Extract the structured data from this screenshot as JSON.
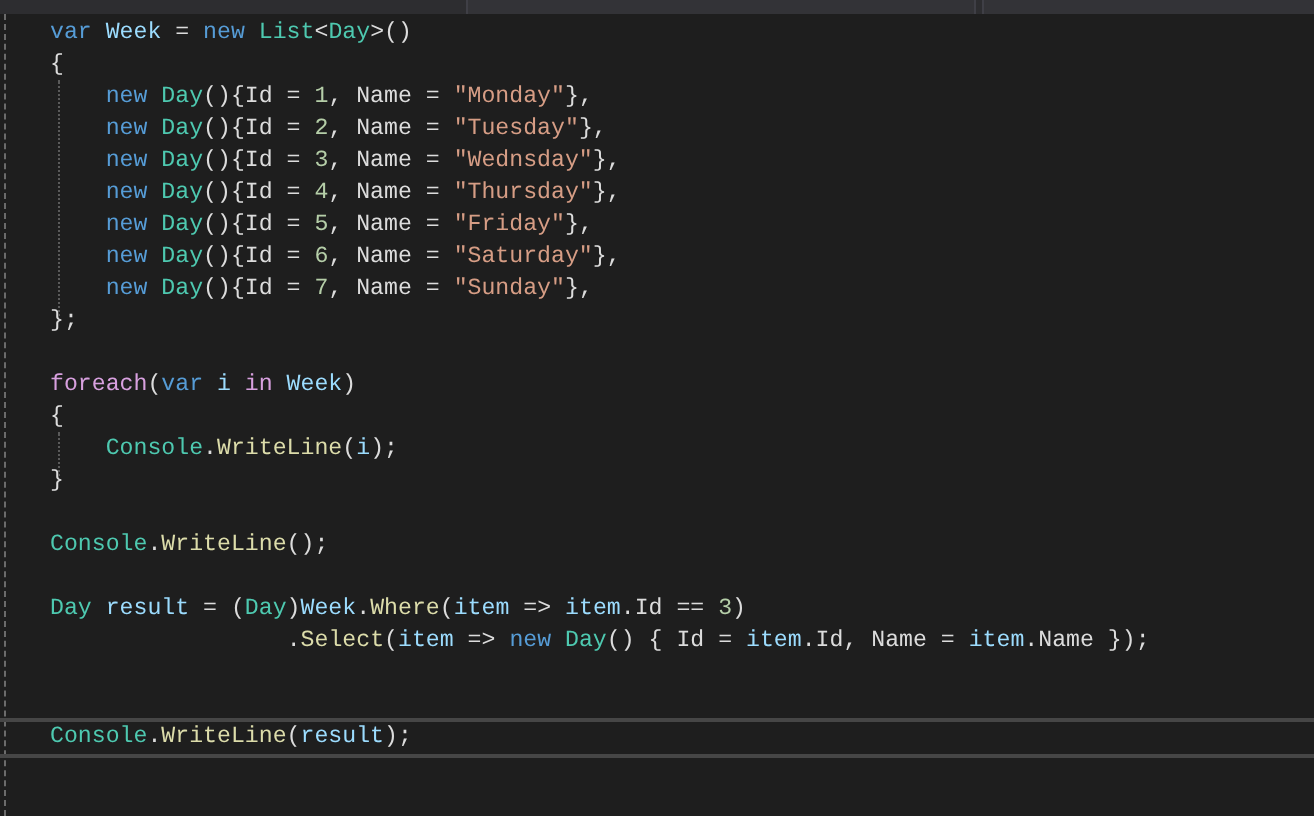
{
  "lines": [
    {
      "kind": "code",
      "tokens": [
        {
          "text": "var",
          "kind": "keyword"
        },
        {
          "text": " Week",
          "kind": "local"
        },
        {
          "text": " = ",
          "kind": "plain"
        },
        {
          "text": "new",
          "kind": "keyword"
        },
        {
          "text": " List",
          "kind": "type"
        },
        {
          "text": "<",
          "kind": "plain"
        },
        {
          "text": "Day",
          "kind": "type"
        },
        {
          "text": ">()",
          "kind": "plain"
        }
      ]
    },
    {
      "kind": "code",
      "tokens": [
        {
          "text": "{",
          "kind": "plain"
        }
      ]
    },
    {
      "kind": "code",
      "tokens": [
        {
          "text": "    new",
          "kind": "keyword"
        },
        {
          "text": " Day",
          "kind": "type"
        },
        {
          "text": "(){Id = ",
          "kind": "plain"
        },
        {
          "text": "1",
          "kind": "number"
        },
        {
          "text": ", Name = ",
          "kind": "plain"
        },
        {
          "text": "\"Monday\"",
          "kind": "string"
        },
        {
          "text": "},",
          "kind": "plain"
        }
      ]
    },
    {
      "kind": "code",
      "tokens": [
        {
          "text": "    new",
          "kind": "keyword"
        },
        {
          "text": " Day",
          "kind": "type"
        },
        {
          "text": "(){Id = ",
          "kind": "plain"
        },
        {
          "text": "2",
          "kind": "number"
        },
        {
          "text": ", Name = ",
          "kind": "plain"
        },
        {
          "text": "\"Tuesday\"",
          "kind": "string"
        },
        {
          "text": "},",
          "kind": "plain"
        }
      ]
    },
    {
      "kind": "code",
      "tokens": [
        {
          "text": "    new",
          "kind": "keyword"
        },
        {
          "text": " Day",
          "kind": "type"
        },
        {
          "text": "(){Id = ",
          "kind": "plain"
        },
        {
          "text": "3",
          "kind": "number"
        },
        {
          "text": ", Name = ",
          "kind": "plain"
        },
        {
          "text": "\"Wednsday\"",
          "kind": "string"
        },
        {
          "text": "},",
          "kind": "plain"
        }
      ]
    },
    {
      "kind": "code",
      "tokens": [
        {
          "text": "    new",
          "kind": "keyword"
        },
        {
          "text": " Day",
          "kind": "type"
        },
        {
          "text": "(){Id = ",
          "kind": "plain"
        },
        {
          "text": "4",
          "kind": "number"
        },
        {
          "text": ", Name = ",
          "kind": "plain"
        },
        {
          "text": "\"Thursday\"",
          "kind": "string"
        },
        {
          "text": "},",
          "kind": "plain"
        }
      ]
    },
    {
      "kind": "code",
      "tokens": [
        {
          "text": "    new",
          "kind": "keyword"
        },
        {
          "text": " Day",
          "kind": "type"
        },
        {
          "text": "(){Id = ",
          "kind": "plain"
        },
        {
          "text": "5",
          "kind": "number"
        },
        {
          "text": ", Name = ",
          "kind": "plain"
        },
        {
          "text": "\"Friday\"",
          "kind": "string"
        },
        {
          "text": "},",
          "kind": "plain"
        }
      ]
    },
    {
      "kind": "code",
      "tokens": [
        {
          "text": "    new",
          "kind": "keyword"
        },
        {
          "text": " Day",
          "kind": "type"
        },
        {
          "text": "(){Id = ",
          "kind": "plain"
        },
        {
          "text": "6",
          "kind": "number"
        },
        {
          "text": ", Name = ",
          "kind": "plain"
        },
        {
          "text": "\"Saturday\"",
          "kind": "string"
        },
        {
          "text": "},",
          "kind": "plain"
        }
      ]
    },
    {
      "kind": "code",
      "tokens": [
        {
          "text": "    new",
          "kind": "keyword"
        },
        {
          "text": " Day",
          "kind": "type"
        },
        {
          "text": "(){Id = ",
          "kind": "plain"
        },
        {
          "text": "7",
          "kind": "number"
        },
        {
          "text": ", Name = ",
          "kind": "plain"
        },
        {
          "text": "\"Sunday\"",
          "kind": "string"
        },
        {
          "text": "},",
          "kind": "plain"
        }
      ]
    },
    {
      "kind": "code",
      "tokens": [
        {
          "text": "};",
          "kind": "plain"
        }
      ]
    },
    {
      "kind": "blank"
    },
    {
      "kind": "code",
      "tokens": [
        {
          "text": "foreach",
          "kind": "control"
        },
        {
          "text": "(",
          "kind": "plain"
        },
        {
          "text": "var",
          "kind": "keyword"
        },
        {
          "text": " i",
          "kind": "local"
        },
        {
          "text": " in",
          "kind": "control"
        },
        {
          "text": " Week",
          "kind": "local"
        },
        {
          "text": ")",
          "kind": "plain"
        }
      ]
    },
    {
      "kind": "code",
      "tokens": [
        {
          "text": "{",
          "kind": "plain"
        }
      ]
    },
    {
      "kind": "code",
      "tokens": [
        {
          "text": "    Console",
          "kind": "type"
        },
        {
          "text": ".",
          "kind": "plain"
        },
        {
          "text": "WriteLine",
          "kind": "method"
        },
        {
          "text": "(",
          "kind": "plain"
        },
        {
          "text": "i",
          "kind": "local"
        },
        {
          "text": ");",
          "kind": "plain"
        }
      ]
    },
    {
      "kind": "code",
      "tokens": [
        {
          "text": "}",
          "kind": "plain"
        }
      ]
    },
    {
      "kind": "blank"
    },
    {
      "kind": "code",
      "tokens": [
        {
          "text": "Console",
          "kind": "type"
        },
        {
          "text": ".",
          "kind": "plain"
        },
        {
          "text": "WriteLine",
          "kind": "method"
        },
        {
          "text": "();",
          "kind": "plain"
        }
      ]
    },
    {
      "kind": "blank"
    },
    {
      "kind": "code",
      "tokens": [
        {
          "text": "Day",
          "kind": "type"
        },
        {
          "text": " result",
          "kind": "local"
        },
        {
          "text": " = (",
          "kind": "plain"
        },
        {
          "text": "Day",
          "kind": "type"
        },
        {
          "text": ")",
          "kind": "plain"
        },
        {
          "text": "Week",
          "kind": "local"
        },
        {
          "text": ".",
          "kind": "plain"
        },
        {
          "text": "Where",
          "kind": "method"
        },
        {
          "text": "(",
          "kind": "plain"
        },
        {
          "text": "item",
          "kind": "local"
        },
        {
          "text": " => ",
          "kind": "plain"
        },
        {
          "text": "item",
          "kind": "local"
        },
        {
          "text": ".Id == ",
          "kind": "plain"
        },
        {
          "text": "3",
          "kind": "number"
        },
        {
          "text": ")",
          "kind": "plain"
        }
      ]
    },
    {
      "kind": "code",
      "tokens": [
        {
          "text": "                 .",
          "kind": "plain"
        },
        {
          "text": "Select",
          "kind": "method"
        },
        {
          "text": "(",
          "kind": "plain"
        },
        {
          "text": "item",
          "kind": "local"
        },
        {
          "text": " => ",
          "kind": "plain"
        },
        {
          "text": "new",
          "kind": "keyword"
        },
        {
          "text": " Day",
          "kind": "type"
        },
        {
          "text": "() { Id = ",
          "kind": "plain"
        },
        {
          "text": "item",
          "kind": "local"
        },
        {
          "text": ".Id, Name = ",
          "kind": "plain"
        },
        {
          "text": "item",
          "kind": "local"
        },
        {
          "text": ".Name });",
          "kind": "plain"
        }
      ]
    },
    {
      "kind": "blank"
    },
    {
      "kind": "blank"
    },
    {
      "kind": "code",
      "current": true,
      "tokens": [
        {
          "text": "Console",
          "kind": "type"
        },
        {
          "text": ".",
          "kind": "plain"
        },
        {
          "text": "WriteLine",
          "kind": "method"
        },
        {
          "text": "(",
          "kind": "plain"
        },
        {
          "text": "result",
          "kind": "local"
        },
        {
          "text": ");",
          "kind": "plain"
        }
      ]
    }
  ]
}
